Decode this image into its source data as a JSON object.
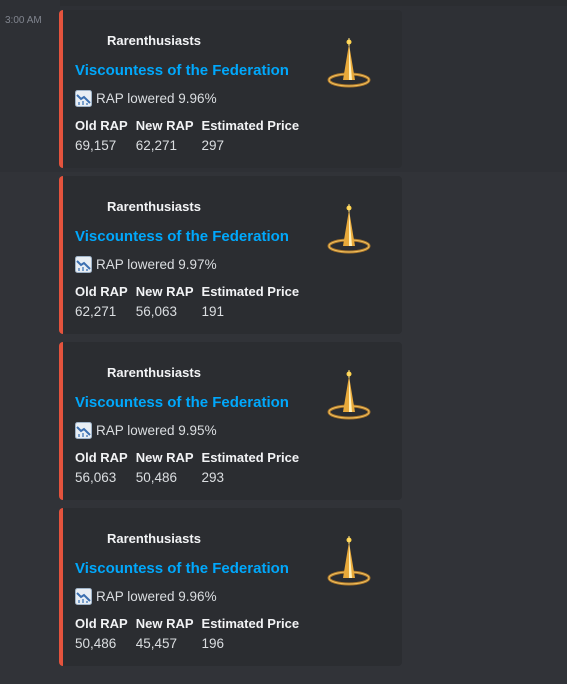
{
  "message": {
    "timestamp": "3:00 AM"
  },
  "embeds": [
    {
      "author": "Rarenthusiasts",
      "title": "Viscountess of the Federation",
      "description": "RAP lowered 9.96%",
      "fields": [
        {
          "name": "Old RAP",
          "value": "69,157"
        },
        {
          "name": "New RAP",
          "value": "62,271"
        },
        {
          "name": "Estimated Price",
          "value": "297"
        }
      ]
    },
    {
      "author": "Rarenthusiasts",
      "title": "Viscountess of the Federation",
      "description": "RAP lowered 9.97%",
      "fields": [
        {
          "name": "Old RAP",
          "value": "62,271"
        },
        {
          "name": "New RAP",
          "value": "56,063"
        },
        {
          "name": "Estimated Price",
          "value": "191"
        }
      ]
    },
    {
      "author": "Rarenthusiasts",
      "title": "Viscountess of the Federation",
      "description": "RAP lowered 9.95%",
      "fields": [
        {
          "name": "Old RAP",
          "value": "56,063"
        },
        {
          "name": "New RAP",
          "value": "50,486"
        },
        {
          "name": "Estimated Price",
          "value": "293"
        }
      ]
    },
    {
      "author": "Rarenthusiasts",
      "title": "Viscountess of the Federation",
      "description": "RAP lowered 9.96%",
      "fields": [
        {
          "name": "Old RAP",
          "value": "50,486"
        },
        {
          "name": "New RAP",
          "value": "45,457"
        },
        {
          "name": "Estimated Price",
          "value": "196"
        }
      ]
    }
  ],
  "icons": {
    "description_icon": "chart-decreasing-icon",
    "thumbnail": "viscountess-crown-icon"
  },
  "colors": {
    "background": "#313338",
    "embed_background": "#2b2d31",
    "embed_accent": "#e4533d",
    "link": "#00a8fc"
  }
}
